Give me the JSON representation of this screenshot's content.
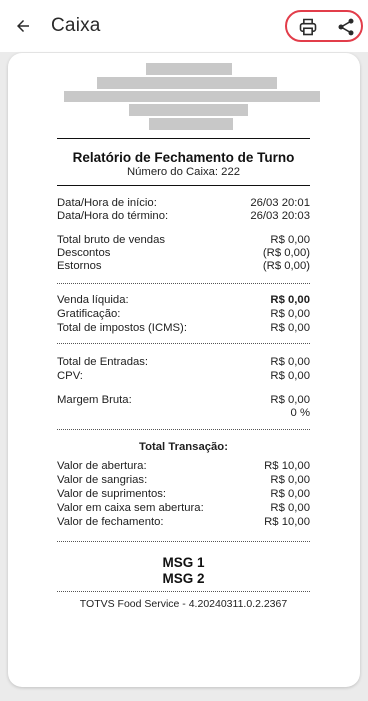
{
  "app": {
    "title": "Caixa"
  },
  "icons": {
    "back": "arrow-left-icon",
    "print": "printer-icon",
    "share": "share-icon"
  },
  "colors": {
    "highlight": "#e23d4a",
    "background": "#ebebeb"
  },
  "report": {
    "title": "Relatório de Fechamento de Turno",
    "register_number": "Número do Caixa: 222",
    "dates": [
      {
        "label": "Data/Hora de início:",
        "value": "26/03 20:01"
      },
      {
        "label": "Data/Hora do término:",
        "value": "26/03 20:03"
      }
    ],
    "sales": [
      {
        "label": "Total bruto de vendas",
        "value": "R$ 0,00"
      },
      {
        "label": "Descontos",
        "value": "(R$ 0,00)"
      },
      {
        "label": "Estornos",
        "value": "(R$ 0,00)"
      }
    ],
    "net": [
      {
        "label": "Venda líquida:",
        "value": "R$ 0,00"
      },
      {
        "label": "Gratificação:",
        "value": "R$ 0,00"
      },
      {
        "label": "Total de impostos (ICMS):",
        "value": "R$ 0,00"
      }
    ],
    "entries": [
      {
        "label": "Total de Entradas:",
        "value": "R$ 0,00"
      },
      {
        "label": "CPV:",
        "value": "R$ 0,00"
      }
    ],
    "margin": {
      "label": "Margem Bruta:",
      "value": "R$ 0,00",
      "percent": "0 %"
    },
    "transaction_title": "Total Transação:",
    "transaction": [
      {
        "label": "Valor de abertura:",
        "value": "R$ 10,00"
      },
      {
        "label": "Valor de sangrias:",
        "value": "R$ 0,00"
      },
      {
        "label": "Valor de suprimentos:",
        "value": "R$ 0,00"
      },
      {
        "label": "Valor em caixa sem abertura:",
        "value": "R$ 0,00"
      },
      {
        "label": "Valor de fechamento:",
        "value": "R$ 10,00"
      }
    ],
    "messages": [
      "MSG 1",
      "MSG 2"
    ],
    "footer": "TOTVS Food Service - 4.20240311.0.2.2367"
  }
}
